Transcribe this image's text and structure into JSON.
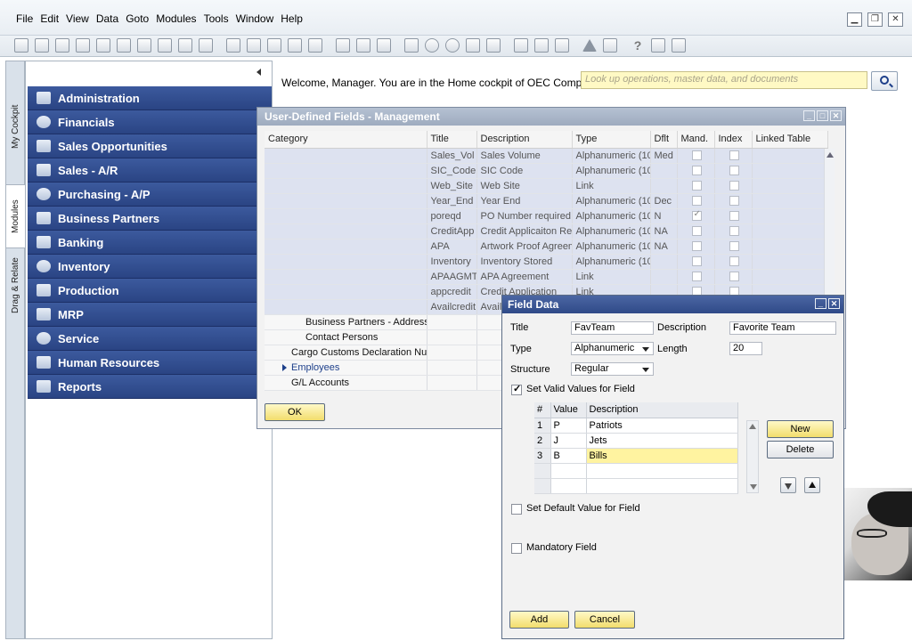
{
  "menubar": {
    "items": [
      "File",
      "Edit",
      "View",
      "Data",
      "Goto",
      "Modules",
      "Tools",
      "Window",
      "Help"
    ],
    "window_controls": [
      "minimize-icon",
      "restore-icon",
      "close-icon"
    ]
  },
  "toolbar": {
    "icons": [
      "preview-icon",
      "print-icon",
      "email-icon",
      "sms-icon",
      "fax-icon",
      "excel-icon",
      "word-icon",
      "pdf-icon",
      "launch-icon",
      "lock-icon",
      "find-icon",
      "first-record-icon",
      "previous-record-icon",
      "next-record-icon",
      "last-record-icon",
      "filter-icon",
      "sort-icon",
      "base-document-icon",
      "target-document-icon",
      "gross-profit-icon",
      "payment-means-icon",
      "volume-weight-icon",
      "journal-icon",
      "edit-icon",
      "settings-icon",
      "form-settings-icon",
      "alert-icon",
      "calendar-icon",
      "help-icon",
      "drag-relate-icon",
      "message-icon"
    ]
  },
  "vtabs": {
    "cockpit": "My Cockpit",
    "modules": "Modules",
    "drag": "Drag & Relate"
  },
  "modules": [
    {
      "label": "Administration",
      "icon": "administration-icon"
    },
    {
      "label": "Financials",
      "icon": "financials-icon"
    },
    {
      "label": "Sales Opportunities",
      "icon": "sales-opportunities-icon"
    },
    {
      "label": "Sales - A/R",
      "icon": "sales-tag-icon"
    },
    {
      "label": "Purchasing - A/P",
      "icon": "cart-icon"
    },
    {
      "label": "Business Partners",
      "icon": "business-partners-icon"
    },
    {
      "label": "Banking",
      "icon": "banking-icon"
    },
    {
      "label": "Inventory",
      "icon": "inventory-box-icon"
    },
    {
      "label": "Production",
      "icon": "production-gear-icon"
    },
    {
      "label": "MRP",
      "icon": "mrp-icon"
    },
    {
      "label": "Service",
      "icon": "service-wrench-icon"
    },
    {
      "label": "Human Resources",
      "icon": "human-resources-icon"
    },
    {
      "label": "Reports",
      "icon": "reports-chart-icon"
    }
  ],
  "cockpit": {
    "welcome": "Welcome, Manager. You are in the Home cockpit of OEC Computers.",
    "search_placeholder": "Look up operations, master data, and documents"
  },
  "udf": {
    "title": "User-Defined Fields - Management",
    "columns": [
      "Category",
      "Title",
      "Description",
      "Type",
      "Dflt",
      "Mand.",
      "Index",
      "Linked Table"
    ],
    "fields": [
      {
        "title": "Sales_Vol",
        "desc": "Sales Volume",
        "type": "Alphanumeric (10",
        "dflt": "Med",
        "mand": false
      },
      {
        "title": "SIC_Code",
        "desc": "SIC Code",
        "type": "Alphanumeric (10",
        "dflt": "",
        "mand": false
      },
      {
        "title": "Web_Site",
        "desc": "Web Site",
        "type": "Link",
        "dflt": "",
        "mand": false
      },
      {
        "title": "Year_End",
        "desc": "Year End",
        "type": "Alphanumeric (10",
        "dflt": "Dec",
        "mand": false
      },
      {
        "title": "poreqd",
        "desc": "PO Number required",
        "type": "Alphanumeric (10",
        "dflt": "N",
        "mand": true
      },
      {
        "title": "CreditApp",
        "desc": "Credit Applicaiton Rec",
        "type": "Alphanumeric (10",
        "dflt": "NA",
        "mand": false
      },
      {
        "title": "APA",
        "desc": "Artwork Proof Agreem",
        "type": "Alphanumeric (10",
        "dflt": "NA",
        "mand": false
      },
      {
        "title": "Inventory",
        "desc": "Inventory Stored",
        "type": "Alphanumeric (10",
        "dflt": "",
        "mand": false
      },
      {
        "title": "APAAGMT",
        "desc": "APA Agreement",
        "type": "Link",
        "dflt": "",
        "mand": false
      },
      {
        "title": "appcredit",
        "desc": "Credit Application",
        "type": "Link",
        "dflt": "",
        "mand": false
      },
      {
        "title": "Availcredit",
        "desc": "Avail",
        "type": "",
        "dflt": "",
        "mand": false
      }
    ],
    "categories": [
      {
        "label": "Business Partners - Addresse",
        "indent": 46,
        "arrow": false,
        "link": false
      },
      {
        "label": "Contact Persons",
        "indent": 46,
        "arrow": false,
        "link": false
      },
      {
        "label": "Cargo Customs Declaration Num",
        "indent": 30,
        "arrow": false,
        "link": false
      },
      {
        "label": "Employees",
        "indent": 30,
        "arrow": true,
        "link": true
      },
      {
        "label": "G/L Accounts",
        "indent": 30,
        "arrow": false,
        "link": false
      }
    ],
    "ok_label": "OK"
  },
  "field_data": {
    "title": "Field Data",
    "title_label": "Title",
    "title_value": "FavTeam",
    "description_label": "Description",
    "description_value": "Favorite Team",
    "type_label": "Type",
    "type_value": "Alphanumeric",
    "length_label": "Length",
    "length_value": "20",
    "structure_label": "Structure",
    "structure_value": "Regular",
    "set_valid_values_label": "Set Valid Values for Field",
    "valid_values_columns": [
      "#",
      "Value",
      "Description"
    ],
    "valid_values": [
      {
        "n": "1",
        "value": "P",
        "description": "Patriots"
      },
      {
        "n": "2",
        "value": "J",
        "description": "Jets"
      },
      {
        "n": "3",
        "value": "B",
        "description": "Bills"
      }
    ],
    "new_label": "New",
    "delete_label": "Delete",
    "set_default_label": "Set Default Value for Field",
    "mandatory_label": "Mandatory Field",
    "add_label": "Add",
    "cancel_label": "Cancel"
  }
}
